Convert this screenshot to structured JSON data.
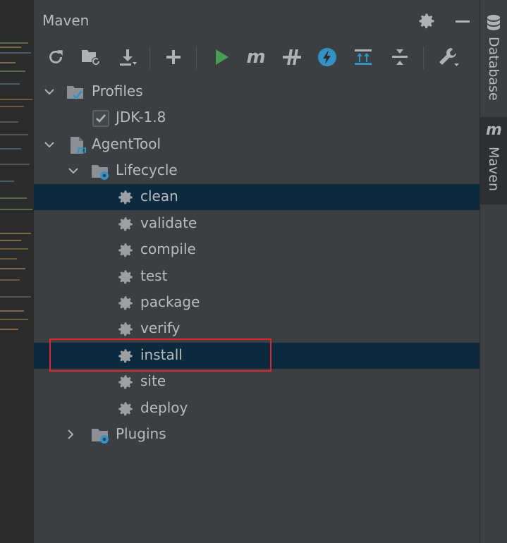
{
  "panel": {
    "title": "Maven",
    "header_icons": [
      "gear-icon",
      "minimize-icon"
    ]
  },
  "toolbar": {
    "buttons": [
      {
        "name": "reload-all-projects",
        "icon": "refresh-icon"
      },
      {
        "name": "generate-sources",
        "icon": "folder-refresh-icon"
      },
      {
        "name": "download-sources",
        "icon": "download-icon"
      },
      {
        "name": "add-maven-project",
        "icon": "plus-icon"
      },
      {
        "name": "run-maven-build",
        "icon": "run-icon"
      },
      {
        "name": "execute-maven-goal",
        "icon": "maven-m-icon"
      },
      {
        "name": "toggle-offline-mode",
        "icon": "offline-icon"
      },
      {
        "name": "skip-tests",
        "icon": "lightning-icon"
      },
      {
        "name": "show-dependencies",
        "icon": "dependencies-icon"
      },
      {
        "name": "collapse-all",
        "icon": "collapse-icon"
      },
      {
        "name": "maven-settings",
        "icon": "wrench-icon"
      }
    ]
  },
  "tree": {
    "profiles": {
      "label": "Profiles",
      "items": [
        {
          "label": "JDK-1.8",
          "checked": true
        }
      ]
    },
    "project": {
      "label": "AgentTool"
    },
    "lifecycle": {
      "label": "Lifecycle",
      "goals": [
        "clean",
        "validate",
        "compile",
        "test",
        "package",
        "verify",
        "install",
        "site",
        "deploy"
      ],
      "selected": [
        "clean",
        "install"
      ],
      "highlighted": "install"
    },
    "plugins": {
      "label": "Plugins"
    }
  },
  "side_tabs": {
    "database": "Database",
    "maven": "Maven"
  },
  "colors": {
    "panel_bg": "#3c3f41",
    "selection_bg": "#0d293e",
    "highlight_border": "#e0262d",
    "run_green": "#499c54",
    "accent_blue": "#3592c4"
  }
}
